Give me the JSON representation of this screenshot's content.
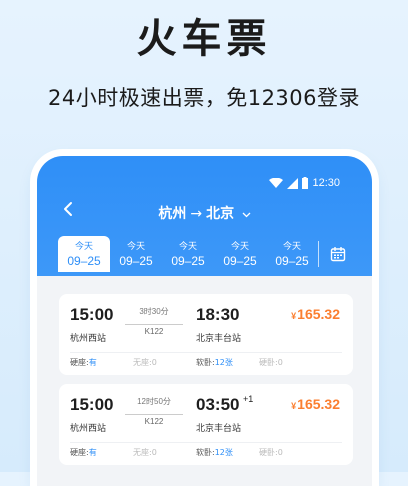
{
  "promo": {
    "headline": "火车票",
    "subline": "24小时极速出票，免12306登录"
  },
  "statusbar": {
    "time": "12:30"
  },
  "header": {
    "back_icon": "chevron-left-icon",
    "from": "杭州",
    "arrow": "→",
    "to": "北京",
    "dropdown_icon": "chevron-down-icon",
    "calendar_icon": "calendar-icon"
  },
  "dates": [
    {
      "day": "今天",
      "date": "09–25"
    },
    {
      "day": "今天",
      "date": "09–25"
    },
    {
      "day": "今天",
      "date": "09–25"
    },
    {
      "day": "今天",
      "date": "09–25"
    },
    {
      "day": "今天",
      "date": "09–25"
    }
  ],
  "trains": [
    {
      "dep_time": "15:00",
      "dep_station": "杭州西站",
      "duration": "3时30分",
      "train_no": "K122",
      "arr_time": "18:30",
      "arr_day_offset": "",
      "arr_station": "北京丰台站",
      "currency": "¥",
      "price": "165.32",
      "seats": [
        {
          "type": "硬座:",
          "status": "有"
        },
        {
          "type": "无座:",
          "status": "0"
        },
        {
          "type": "软卧:",
          "status": "12张"
        },
        {
          "type": "硬卧:",
          "status": "0"
        }
      ]
    },
    {
      "dep_time": "15:00",
      "dep_station": "杭州西站",
      "duration": "12时50分",
      "train_no": "K122",
      "arr_time": "03:50",
      "arr_day_offset": "+1",
      "arr_station": "北京丰台站",
      "currency": "¥",
      "price": "165.32",
      "seats": [
        {
          "type": "硬座:",
          "status": "有"
        },
        {
          "type": "无座:",
          "status": "0"
        },
        {
          "type": "软卧:",
          "status": "12张"
        },
        {
          "type": "硬卧:",
          "status": "0"
        }
      ]
    }
  ],
  "colors": {
    "accent": "#2f8ff7",
    "price": "#fb7f30"
  }
}
